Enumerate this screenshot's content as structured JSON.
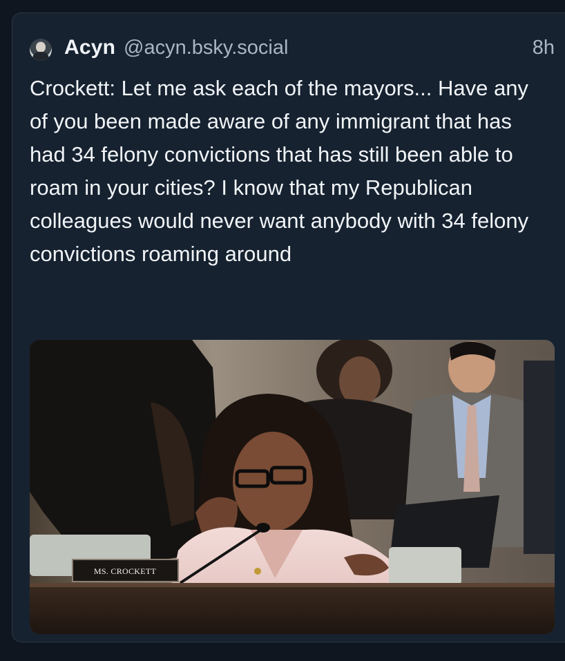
{
  "post": {
    "author": {
      "display_name": "Acyn",
      "handle": "@acyn.bsky.social",
      "avatar_icon": "avatar-photo"
    },
    "timestamp": "8h",
    "text": "Crockett: Let me ask each of the mayors... Have any of you been made aware of any immigrant that has had 34 felony convictions that has still been able to roam in your cities? I know that my Republican colleagues would never want anybody with 34 felony convictions roaming around",
    "media": {
      "nameplate": "MS. CROCKETT"
    }
  },
  "theme": {
    "background": "#0f1620",
    "card": "#162230",
    "text_primary": "#f1f4f7",
    "text_secondary": "#aab6c3"
  }
}
